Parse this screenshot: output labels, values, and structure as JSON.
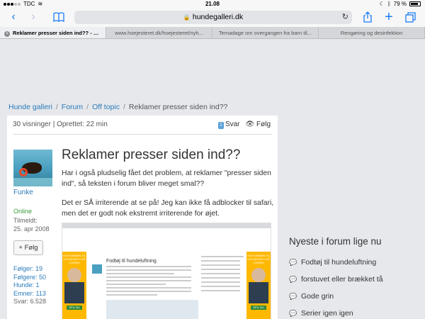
{
  "status": {
    "carrier": "TDC",
    "time": "21.08",
    "battery": "79 %"
  },
  "toolbar": {
    "url": "hundegalleri.dk"
  },
  "tabs": [
    {
      "label": "Reklamer presser siden ind?? - Skr...",
      "active": true
    },
    {
      "label": "www.hoejesteret.dk/hoejesteret/nyh..."
    },
    {
      "label": "Temadage om overgangen fra barn til..."
    },
    {
      "label": "Rengøring og desinfektion"
    }
  ],
  "breadcrumb": {
    "items": [
      "Hunde galleri",
      "Forum",
      "Off topic"
    ],
    "current": "Reklamer presser siden ind??",
    "separator": "/"
  },
  "post": {
    "header_meta": "30 visninger | Oprettet: 22 min",
    "reply_count": "1",
    "reply_label": "Svar",
    "follow_label": "Følg",
    "title": "Reklamer presser siden ind??",
    "paragraphs": [
      "Har i også pludselig fået det problem, at reklamer \"presser siden ind\", så teksten i forum bliver meget smal??",
      "Det er SÅ irriterende at se på! Jeg kan ikke få adblocker til safari, men det er godt nok ekstremt irriterende for øjet."
    ]
  },
  "author": {
    "name": "Funke",
    "status": "Online",
    "joined_label": "Tilmeldt:",
    "joined_date": "25. apr 2008",
    "follow_button": "+ Følg",
    "stats": [
      "Følger: 19",
      "Følgere: 50",
      "Hunde: 1",
      "Emner: 113",
      "Svar: 6.528"
    ]
  },
  "screenshot": {
    "title": "Fodtøj til hundeluftning",
    "ad_text": "VELKOMMEN TIL LEOVEGAS LIVE CASINO",
    "ad_button": "SPIL NU"
  },
  "sidebar": {
    "title": "Nyeste i forum lige nu",
    "items": [
      "Fodtøj til hundeluftning",
      "forstuvet eller brækket tå",
      "Gode grin",
      "Serier igen igen"
    ]
  },
  "colors": {
    "link": "#2a7ab8",
    "online": "#3a9a3a",
    "safari_blue": "#1a7cf5",
    "ad_yellow": "#ffb800"
  }
}
